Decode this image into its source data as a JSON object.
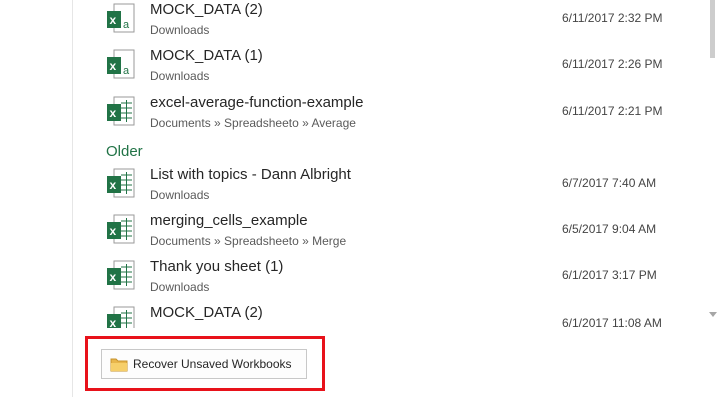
{
  "recent": {
    "items_today": [
      {
        "name": "MOCK_DATA (2)",
        "path": "Downloads",
        "date": "6/11/2017 2:32 PM",
        "icon": "excel-csv-icon"
      },
      {
        "name": "MOCK_DATA (1)",
        "path": "Downloads",
        "date": "6/11/2017 2:26 PM",
        "icon": "excel-csv-icon"
      },
      {
        "name": "excel-average-function-example",
        "path": "Documents » Spreadsheeto » Average",
        "date": "6/11/2017 2:21 PM",
        "icon": "excel-workbook-icon"
      }
    ],
    "older_label": "Older",
    "items_older": [
      {
        "name": "List with topics - Dann Albright",
        "path": "Downloads",
        "date": "6/7/2017 7:40 AM",
        "icon": "excel-workbook-icon"
      },
      {
        "name": "merging_cells_example",
        "path": "Documents » Spreadsheeto » Merge",
        "date": "6/5/2017 9:04 AM",
        "icon": "excel-workbook-icon"
      },
      {
        "name": "Thank you sheet (1)",
        "path": "Downloads",
        "date": "6/1/2017 3:17 PM",
        "icon": "excel-workbook-icon"
      },
      {
        "name": "MOCK_DATA (2)",
        "path": "",
        "date": "6/1/2017 11:08 AM",
        "icon": "excel-workbook-icon"
      }
    ]
  },
  "recover_button": {
    "label": "Recover Unsaved Workbooks",
    "icon": "folder-icon"
  },
  "colors": {
    "accent_green": "#217346",
    "highlight_red": "#e8121a"
  }
}
